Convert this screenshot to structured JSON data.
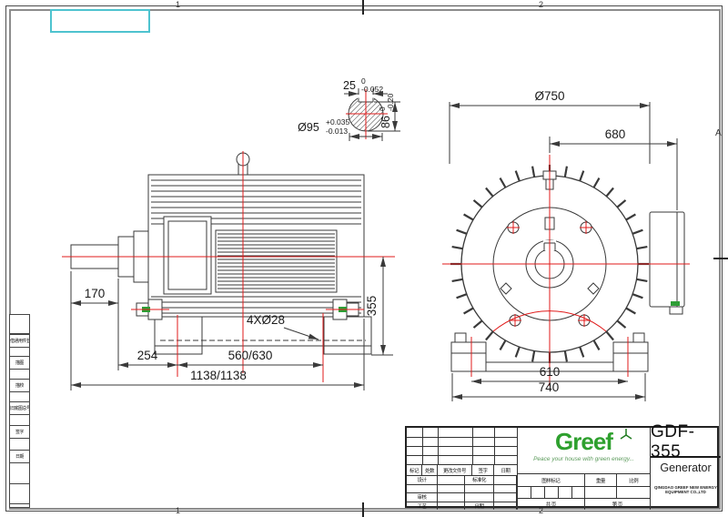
{
  "drawing": {
    "zones": {
      "top_left": "1",
      "top_right": "2",
      "bottom_left": "1",
      "bottom_right": "2",
      "right_row": "A"
    },
    "detail": {
      "key_width": {
        "nominal": "25",
        "upper": "0",
        "lower": "-0.052"
      },
      "shaft_diameter": {
        "nominal": "Ø95",
        "upper": "+0.035",
        "lower": "-0.013"
      },
      "key_depth": {
        "nominal": "86",
        "upper": "0",
        "lower": "-0.20"
      }
    },
    "side_view": {
      "shaft_length": "170",
      "front_foot": "254",
      "foot_spacing": "560/630",
      "overall_length": "1138/1138",
      "foot_holes": "4XØ28",
      "shaft_height": "355"
    },
    "front_view": {
      "outer_diameter": "Ø750",
      "terminal_width": "680",
      "foot_hole_spacing": "610",
      "base_width": "740"
    }
  },
  "margin_strip": {
    "items": [
      "借通用件登记",
      "描图",
      "描校",
      "旧底图总号",
      "签字",
      "日期"
    ]
  },
  "title_block": {
    "revision_header": [
      "标记",
      "处数",
      "更改文件号",
      "签字",
      "日期"
    ],
    "row_design": "设计",
    "row_standard": "标准化",
    "row_check": "审核",
    "row_process": "工艺",
    "row_date": "日期",
    "stamp_header": [
      "图样标记",
      "重量",
      "比例"
    ],
    "sheet_total": "共  页",
    "sheet_number": "第  页",
    "logo_text": "Greef",
    "logo_tagline": "Peace your house with green energy...",
    "model": "GDF-355",
    "product": "Generator",
    "company": "QINGDAO GREEF NEW ENERGY EQUIPMENT CO.,LTD"
  },
  "colors": {
    "centerline": "#e01b1b",
    "highlight": "#4ec3cf",
    "accent_green": "#2e9e36",
    "logo_green": "#2ea02e",
    "line": "#3a3a3a"
  }
}
